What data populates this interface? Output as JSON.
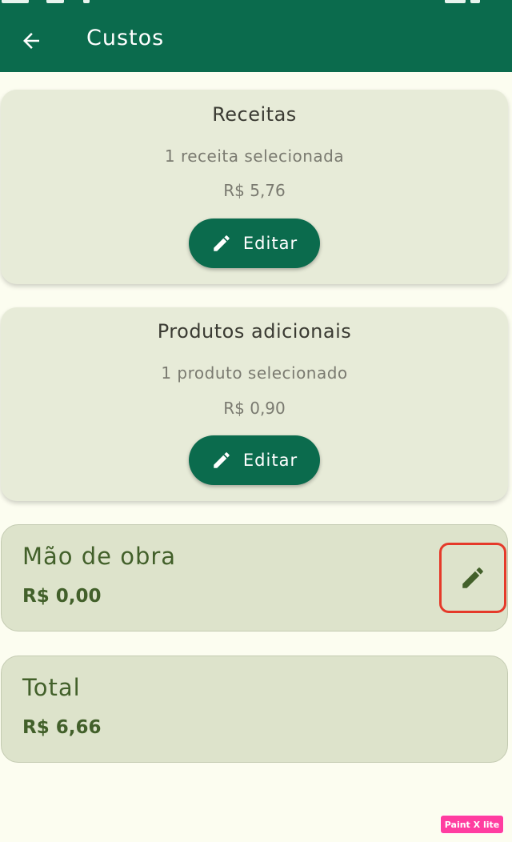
{
  "appbar": {
    "title": "Custos",
    "back_icon": "arrow-left-icon",
    "color": "#0b6b4d"
  },
  "cards": [
    {
      "title": "Receitas",
      "subtitle": "1 receita selecionada",
      "price": "R$ 5,76",
      "button_label": "Editar",
      "button_icon": "pencil-icon"
    },
    {
      "title": "Produtos adicionais",
      "subtitle": "1 produto selecionado",
      "price": "R$ 0,90",
      "button_label": "Editar",
      "button_icon": "pencil-icon"
    }
  ],
  "labor": {
    "title": "Mão de obra",
    "value": "R$ 0,00",
    "edit_icon": "pencil-icon",
    "highlight_color": "#e53a2a"
  },
  "total": {
    "title": "Total",
    "value": "R$ 6,66"
  },
  "watermark": {
    "text": "Paint X lite"
  }
}
